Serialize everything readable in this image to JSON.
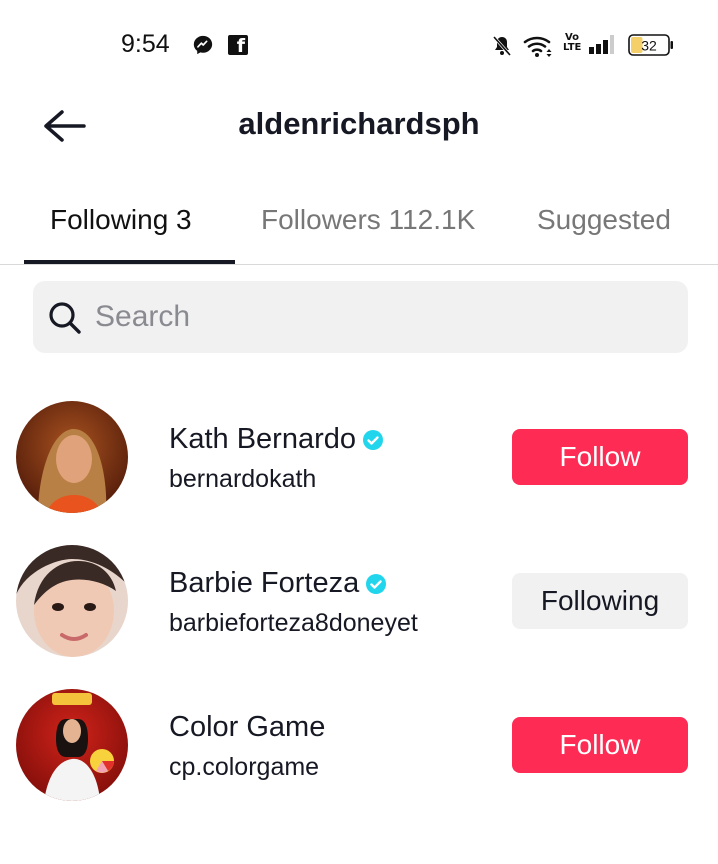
{
  "status_bar": {
    "time": "9:54",
    "icons": [
      "messenger-icon",
      "facebook-icon",
      "bell-muted-icon",
      "wifi-icon",
      "volte-icon",
      "signal-icon",
      "battery-icon"
    ],
    "fb_glyph": "f",
    "volte_top": "Vo",
    "volte_bottom": "LTE",
    "battery_level": "32",
    "battery_fraction": 0.32,
    "battery_fill_color": "#f5d06a"
  },
  "header": {
    "title": "aldenrichardsph",
    "back_icon": "arrow-left-icon"
  },
  "tabs": [
    {
      "label": "Following 3",
      "active": true
    },
    {
      "label": "Followers 112.1K",
      "active": false
    },
    {
      "label": "Suggested",
      "active": false
    }
  ],
  "search": {
    "placeholder": "Search",
    "value": ""
  },
  "users": [
    {
      "name": "Kath Bernardo",
      "handle": "bernardokath",
      "verified": true,
      "button_label": "Follow",
      "button_state": "follow",
      "avatar_colors": [
        "#7a2a10",
        "#c88a4a"
      ]
    },
    {
      "name": "Barbie Forteza",
      "handle": "barbieforteza8doneyet",
      "verified": true,
      "button_label": "Following",
      "button_state": "following",
      "avatar_colors": [
        "#3a2a25",
        "#e9c4b2"
      ]
    },
    {
      "name": "Color Game",
      "handle": "cp.colorgame",
      "verified": false,
      "button_label": "Follow",
      "button_state": "follow",
      "avatar_colors": [
        "#a3150f",
        "#f2f2f2"
      ]
    }
  ],
  "colors": {
    "accent": "#fe2c55",
    "verified": "#20d5ec",
    "text": "#161823",
    "muted": "#777777",
    "secondary_bg": "#f1f1f2"
  }
}
